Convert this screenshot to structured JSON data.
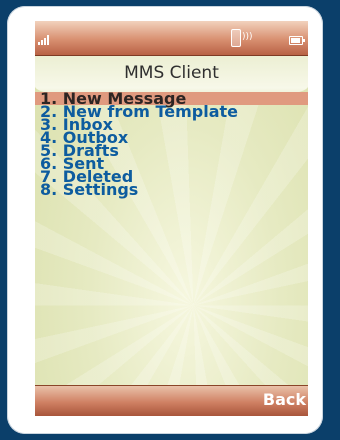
{
  "screen": {
    "title": "MMS Client"
  },
  "menu": {
    "items": [
      "1. New Message",
      "2. New from Template",
      "3. Inbox",
      "4. Outbox",
      "5. Drafts",
      "6. Sent",
      "7. Deleted",
      "8. Settings"
    ],
    "selected_index": 0
  },
  "softkeys": {
    "right_label": "Back"
  },
  "status_icons": [
    "signal-icon",
    "phone-icon",
    "battery-icon"
  ],
  "colors": {
    "menu_text": "#0d5c9f",
    "selection": "#e09a7f",
    "bar": "#cf8063"
  }
}
